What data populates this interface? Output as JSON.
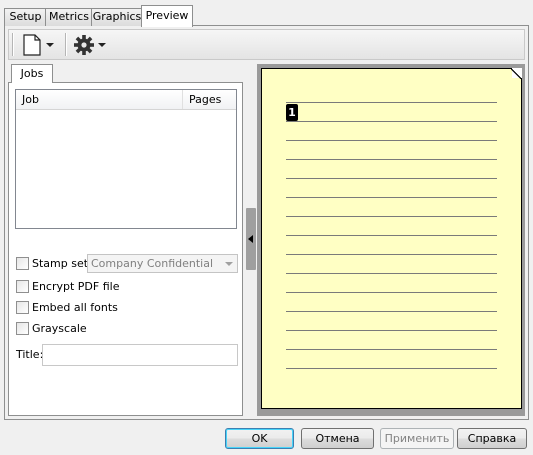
{
  "tabs": [
    {
      "label": "Setup"
    },
    {
      "label": "Metrics"
    },
    {
      "label": "Graphics"
    },
    {
      "label": "Preview",
      "active": true
    }
  ],
  "toolbar": {
    "icons": [
      "new-document-icon",
      "gear-icon"
    ]
  },
  "jobs": {
    "tab_label": "Jobs",
    "columns": [
      "Job",
      "Pages"
    ],
    "rows": []
  },
  "options": {
    "stamp_set_label": "Stamp set:",
    "stamp_set_value": "Company Confidential",
    "encrypt_label": "Encrypt PDF file",
    "embed_fonts_label": "Embed all fonts",
    "grayscale_label": "Grayscale",
    "title_label": "Title:",
    "title_value": ""
  },
  "preview": {
    "page_number": "1",
    "page_color": "#ffffc4"
  },
  "buttons": {
    "ok": "OK",
    "cancel": "Отмена",
    "apply": "Применить",
    "help": "Справка"
  }
}
